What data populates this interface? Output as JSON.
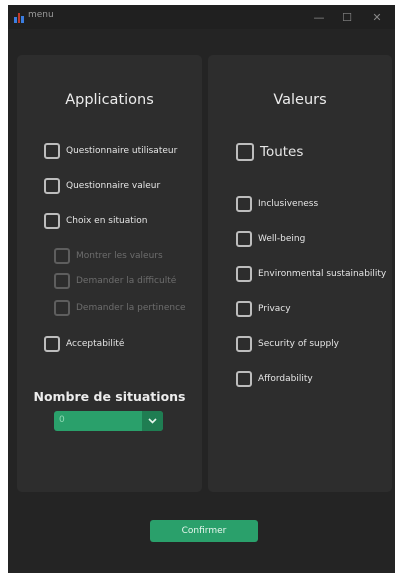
{
  "window": {
    "title": "menu",
    "controls": {
      "minimize": "—",
      "maximize": "☐",
      "close": "✕"
    }
  },
  "applications": {
    "title": "Applications",
    "items": [
      {
        "label": "Questionnaire utilisateur",
        "checked": false,
        "enabled": true
      },
      {
        "label": "Questionnaire valeur",
        "checked": false,
        "enabled": true
      },
      {
        "label": "Choix en situation",
        "checked": false,
        "enabled": true
      },
      {
        "label": "Montrer les valeurs",
        "checked": false,
        "enabled": false
      },
      {
        "label": "Demander la difficulté",
        "checked": false,
        "enabled": false
      },
      {
        "label": "Demander la pertinence",
        "checked": false,
        "enabled": false
      },
      {
        "label": "Acceptabilité",
        "checked": false,
        "enabled": true
      }
    ],
    "situations_label": "Nombre de situations",
    "situations_value": "0"
  },
  "valeurs": {
    "title": "Valeurs",
    "all_label": "Toutes",
    "items": [
      {
        "label": "Inclusiveness",
        "checked": false
      },
      {
        "label": "Well-being",
        "checked": false
      },
      {
        "label": "Environmental sustainability",
        "checked": false
      },
      {
        "label": "Privacy",
        "checked": false
      },
      {
        "label": "Security of supply",
        "checked": false
      },
      {
        "label": "Affordability",
        "checked": false
      }
    ]
  },
  "confirm_label": "Confirmer",
  "colors": {
    "accent": "#2aa06b",
    "accent_dark": "#1f7d52",
    "panel": "#2d2d2d",
    "background": "#242424"
  }
}
